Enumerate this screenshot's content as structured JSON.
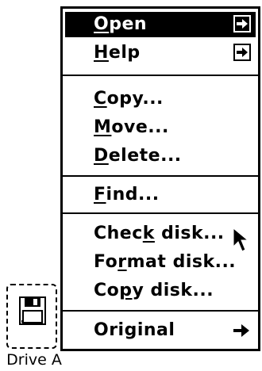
{
  "menu": {
    "items": [
      {
        "pre": "",
        "mnem": "O",
        "post": "pen",
        "arrow": "boxed",
        "selected": true
      },
      {
        "pre": "",
        "mnem": "H",
        "post": "elp",
        "arrow": "boxed",
        "selected": false
      },
      {
        "pre": "",
        "mnem": "C",
        "post": "opy...",
        "arrow": "none",
        "selected": false
      },
      {
        "pre": "",
        "mnem": "M",
        "post": "ove...",
        "arrow": "none",
        "selected": false
      },
      {
        "pre": "",
        "mnem": "D",
        "post": "elete...",
        "arrow": "none",
        "selected": false
      },
      {
        "pre": "",
        "mnem": "F",
        "post": "ind...",
        "arrow": "none",
        "selected": false
      },
      {
        "pre": "Chec",
        "mnem": "k",
        "post": " disk...",
        "arrow": "none",
        "selected": false
      },
      {
        "pre": "Fo",
        "mnem": "r",
        "post": "mat disk...",
        "arrow": "none",
        "selected": false
      },
      {
        "pre": "Co",
        "mnem": "p",
        "post": "y disk...",
        "arrow": "none",
        "selected": false
      },
      {
        "pre": "Original",
        "mnem": "",
        "post": "",
        "arrow": "plain",
        "selected": false
      }
    ]
  },
  "desktop": {
    "drive_label": "Drive A"
  },
  "colors": {
    "highlight": "#000000",
    "background": "#ffffff"
  },
  "icons": {
    "drive": "floppy-disk-icon",
    "submenu": "right-arrow-icon",
    "cursor": "mouse-pointer-icon"
  }
}
